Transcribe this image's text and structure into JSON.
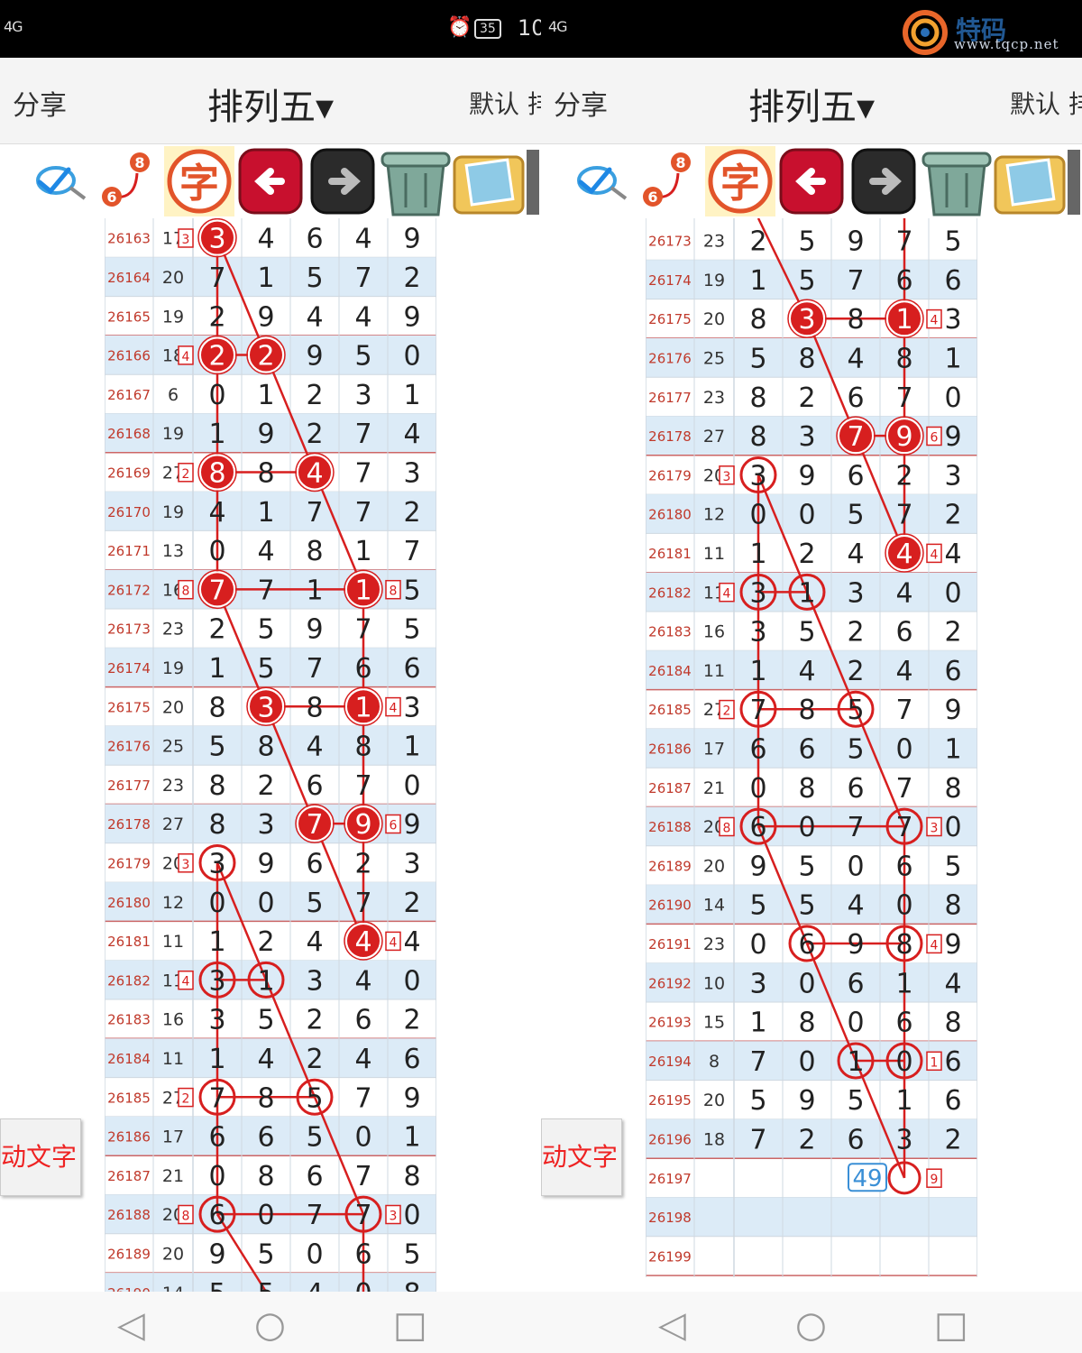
{
  "status_bar": {
    "signal_left": "4G",
    "battery": "35",
    "time": "10",
    "signal_right": "4G"
  },
  "header": {
    "share_label": "分享",
    "title": "排列五▾",
    "default_label": "默认 排"
  },
  "toolbar": {
    "tools": [
      "search-check",
      "number-68",
      "zi-character",
      "back-arrow",
      "forward-arrow",
      "trash-can",
      "photo-album"
    ],
    "zi_label": "字",
    "num_top": "8",
    "num_bottom": "6"
  },
  "float_button": {
    "label": "动文字"
  },
  "watermark": {
    "brand": "特码",
    "url": "www.tqcp.net"
  },
  "rows": [
    {
      "id": "26163",
      "sum": "17",
      "d": [
        3,
        4,
        6,
        4,
        9
      ],
      "note": "3"
    },
    {
      "id": "26164",
      "sum": "20",
      "d": [
        7,
        1,
        5,
        7,
        2
      ]
    },
    {
      "id": "26165",
      "sum": "19",
      "d": [
        2,
        9,
        4,
        4,
        9
      ]
    },
    {
      "id": "26166",
      "sum": "18",
      "d": [
        2,
        2,
        9,
        5,
        0
      ],
      "note": "4"
    },
    {
      "id": "26167",
      "sum": "6",
      "d": [
        0,
        1,
        2,
        3,
        1
      ]
    },
    {
      "id": "26168",
      "sum": "19",
      "d": [
        1,
        9,
        2,
        7,
        4
      ]
    },
    {
      "id": "26169",
      "sum": "27",
      "d": [
        8,
        8,
        4,
        7,
        3
      ],
      "note": "2"
    },
    {
      "id": "26170",
      "sum": "19",
      "d": [
        4,
        1,
        7,
        7,
        2
      ]
    },
    {
      "id": "26171",
      "sum": "13",
      "d": [
        0,
        4,
        8,
        1,
        7
      ]
    },
    {
      "id": "26172",
      "sum": "16",
      "d": [
        7,
        7,
        1,
        1,
        5
      ],
      "note": "8",
      "note2": "8"
    },
    {
      "id": "26173",
      "sum": "23",
      "d": [
        2,
        5,
        9,
        7,
        5
      ]
    },
    {
      "id": "26174",
      "sum": "19",
      "d": [
        1,
        5,
        7,
        6,
        6
      ]
    },
    {
      "id": "26175",
      "sum": "20",
      "d": [
        8,
        3,
        8,
        1,
        3
      ],
      "note2": "4"
    },
    {
      "id": "26176",
      "sum": "25",
      "d": [
        5,
        8,
        4,
        8,
        1
      ]
    },
    {
      "id": "26177",
      "sum": "23",
      "d": [
        8,
        2,
        6,
        7,
        0
      ]
    },
    {
      "id": "26178",
      "sum": "27",
      "d": [
        8,
        3,
        7,
        9,
        9
      ],
      "note2": "6"
    },
    {
      "id": "26179",
      "sum": "20",
      "d": [
        3,
        9,
        6,
        2,
        3
      ],
      "note": "3"
    },
    {
      "id": "26180",
      "sum": "12",
      "d": [
        0,
        0,
        5,
        7,
        2
      ]
    },
    {
      "id": "26181",
      "sum": "11",
      "d": [
        1,
        2,
        4,
        4,
        4
      ],
      "note2": "4"
    },
    {
      "id": "26182",
      "sum": "11",
      "d": [
        3,
        1,
        3,
        4,
        0
      ],
      "note": "4"
    },
    {
      "id": "26183",
      "sum": "16",
      "d": [
        3,
        5,
        2,
        6,
        2
      ]
    },
    {
      "id": "26184",
      "sum": "11",
      "d": [
        1,
        4,
        2,
        4,
        6
      ]
    },
    {
      "id": "26185",
      "sum": "27",
      "d": [
        7,
        8,
        5,
        7,
        9
      ],
      "note": "2"
    },
    {
      "id": "26186",
      "sum": "17",
      "d": [
        6,
        6,
        5,
        0,
        1
      ]
    },
    {
      "id": "26187",
      "sum": "21",
      "d": [
        0,
        8,
        6,
        7,
        8
      ]
    },
    {
      "id": "26188",
      "sum": "20",
      "d": [
        6,
        0,
        7,
        7,
        0
      ],
      "note": "8",
      "note2": "3"
    },
    {
      "id": "26189",
      "sum": "20",
      "d": [
        9,
        5,
        0,
        6,
        5
      ]
    },
    {
      "id": "26190",
      "sum": "14",
      "d": [
        5,
        5,
        4,
        0,
        8
      ]
    },
    {
      "id": "26191",
      "sum": "23",
      "d": [
        0,
        6,
        9,
        8,
        9
      ],
      "note2": "4"
    },
    {
      "id": "26192",
      "sum": "10",
      "d": [
        3,
        0,
        6,
        1,
        4
      ]
    },
    {
      "id": "26193",
      "sum": "15",
      "d": [
        1,
        8,
        0,
        6,
        8
      ]
    },
    {
      "id": "26194",
      "sum": "8",
      "d": [
        7,
        0,
        1,
        0,
        6
      ],
      "note2": "1"
    },
    {
      "id": "26195",
      "sum": "20",
      "d": [
        5,
        9,
        5,
        1,
        6
      ]
    },
    {
      "id": "26196",
      "sum": "18",
      "d": [
        7,
        2,
        6,
        3,
        2
      ]
    },
    {
      "id": "26197",
      "sum": "",
      "d": [],
      "predict": "49",
      "note2": "9"
    },
    {
      "id": "26198",
      "sum": "",
      "d": []
    },
    {
      "id": "26199",
      "sum": "",
      "d": []
    }
  ],
  "highlights": [
    {
      "id": "26163",
      "col": 0,
      "style": "filled"
    },
    {
      "id": "26166",
      "col": 0,
      "style": "filled"
    },
    {
      "id": "26166",
      "col": 1,
      "style": "filled"
    },
    {
      "id": "26169",
      "col": 0,
      "style": "filled"
    },
    {
      "id": "26169",
      "col": 2,
      "style": "filled"
    },
    {
      "id": "26172",
      "col": 0,
      "style": "filled"
    },
    {
      "id": "26172",
      "col": 3,
      "style": "filled"
    },
    {
      "id": "26175",
      "col": 1,
      "style": "filled"
    },
    {
      "id": "26175",
      "col": 3,
      "style": "filled"
    },
    {
      "id": "26178",
      "col": 2,
      "style": "filled"
    },
    {
      "id": "26178",
      "col": 3,
      "style": "filled"
    },
    {
      "id": "26181",
      "col": 3,
      "style": "filled"
    },
    {
      "id": "26179",
      "col": 0,
      "style": "ring"
    },
    {
      "id": "26182",
      "col": 0,
      "style": "ring"
    },
    {
      "id": "26182",
      "col": 1,
      "style": "ring"
    },
    {
      "id": "26185",
      "col": 0,
      "style": "ring"
    },
    {
      "id": "26185",
      "col": 2,
      "style": "ring"
    },
    {
      "id": "26188",
      "col": 0,
      "style": "ring"
    },
    {
      "id": "26188",
      "col": 3,
      "style": "ring"
    },
    {
      "id": "26191",
      "col": 1,
      "style": "ring"
    },
    {
      "id": "26191",
      "col": 3,
      "style": "ring"
    },
    {
      "id": "26194",
      "col": 2,
      "style": "ring"
    },
    {
      "id": "26194",
      "col": 3,
      "style": "ring"
    },
    {
      "id": "26197",
      "col": 3,
      "style": "ring"
    }
  ],
  "panes": [
    {
      "first_row": "26163",
      "last_row": "26190"
    },
    {
      "first_row": "26173",
      "last_row": "26199"
    }
  ],
  "colors": {
    "accent": "#d71f1f",
    "row_stripe": "#dcebf7",
    "id_text": "#c0392b",
    "predict": "#3a8fd6"
  }
}
